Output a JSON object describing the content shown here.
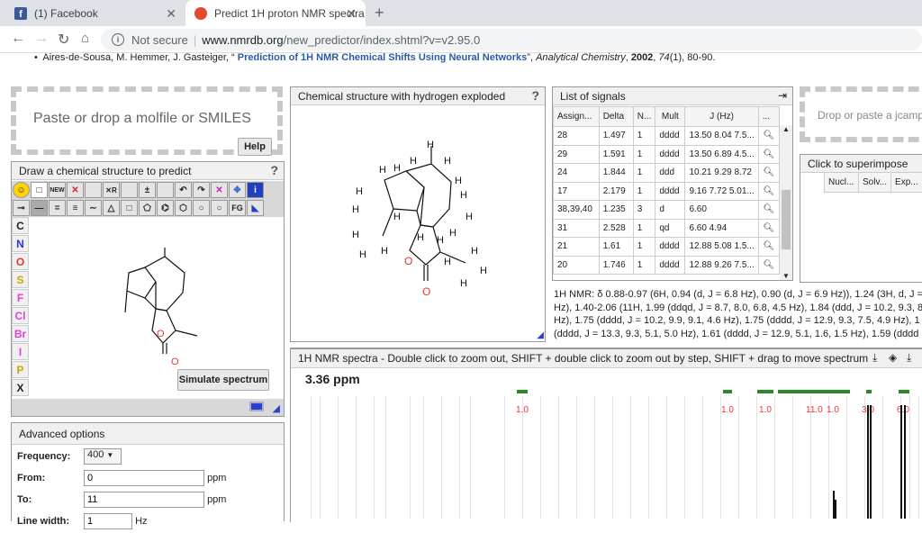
{
  "browser": {
    "tabs": [
      {
        "title": "(1) Facebook",
        "icon": "facebook-icon",
        "color": "#3b5998"
      },
      {
        "title": "Predict 1H proton NMR spectra",
        "icon": "nmrdb-icon",
        "color": "#e04b2b"
      }
    ],
    "not_secure": "Not secure",
    "url_host": "www.nmrdb.org",
    "url_path": "/new_predictor/index.shtml?v=v2.95.0"
  },
  "reference": {
    "authors": "Aires-de-Sousa, M. Hemmer, J. Gasteiger, “ ",
    "title": "Prediction of 1H NMR Chemical Shifts Using Neural Networks",
    "journal_pre": "”, ",
    "journal": "Analytical Chemistry",
    "sep1": ", ",
    "year": "2002",
    "sep2": ", ",
    "volume": "74",
    "pages": "(1), 80-90."
  },
  "paste": {
    "placeholder": "Paste or drop a molfile or SMILES",
    "help": "Help"
  },
  "editor": {
    "title": "Draw a chemical structure to predict",
    "help": "?",
    "atoms": [
      "C",
      "N",
      "O",
      "S",
      "F",
      "Cl",
      "Br",
      "I",
      "P",
      "X"
    ],
    "atom_colors": [
      "#333",
      "#2d33d8",
      "#e33",
      "#c8a800",
      "#d4d",
      "#d4d",
      "#d4d",
      "#d4d",
      "#c8a800",
      "#333"
    ],
    "simulate": "Simulate spectrum",
    "tool_new": "NEW",
    "tool_fg": "FG"
  },
  "exploded": {
    "title": "Chemical structure with hydrogen exploded",
    "help": "?"
  },
  "signals": {
    "title": "List of signals",
    "columns": [
      "Assign...",
      "Delta",
      "N...",
      "Mult",
      "J (Hz)",
      "..."
    ],
    "rows": [
      [
        "28",
        "1.497",
        "1",
        "dddd",
        "13.50 8.04 7.5..."
      ],
      [
        "29",
        "1.591",
        "1",
        "dddd",
        "13.50 6.89 4.5..."
      ],
      [
        "24",
        "1.844",
        "1",
        "ddd",
        "10.21 9.29 8.72"
      ],
      [
        "17",
        "2.179",
        "1",
        "dddd",
        "9.16 7.72 5.01..."
      ],
      [
        "38,39,40",
        "1.235",
        "3",
        "d",
        "6.60"
      ],
      [
        "31",
        "2.528",
        "1",
        "qd",
        "6.60 4.94"
      ],
      [
        "21",
        "1.61",
        "1",
        "dddd",
        "12.88 5.08 1.5..."
      ],
      [
        "20",
        "1.746",
        "1",
        "dddd",
        "12.88 9.26 7.5..."
      ]
    ]
  },
  "nmr_text": {
    "line1": "1H NMR: δ 0.88-0.97 (6H, 0.94 (d, J = 6.8 Hz), 0.90 (d, J = 6.9 Hz)), 1.24 (3H, d, J =",
    "line2": "Hz), 1.40-2.06 (11H, 1.99 (ddqd, J = 8.7, 8.0, 6.8, 4.5 Hz), 1.84 (ddd, J = 10.2, 9.3, 8.",
    "line3": "Hz), 1.75 (dddd, J = 10.2, 9.9, 9.1, 4.6 Hz), 1.75 (dddd, J = 12.9, 9.3, 7.5, 4.9 Hz), 1",
    "line4": "(dddd, J = 13.3, 9.3, 5.1, 5.0 Hz), 1.61 (dddd, J = 12.9, 5.1, 1.6, 1.5 Hz), 1.59 (dddd"
  },
  "jcamp": {
    "placeholder": "Drop or paste a jcamp"
  },
  "superimpose": {
    "title": "Click to superimpose",
    "columns": [
      "Nucl...",
      "Solv...",
      "Exp..."
    ]
  },
  "advanced": {
    "title": "Advanced options",
    "frequency_label": "Frequency:",
    "frequency": "400",
    "from_label": "From:",
    "from": "0",
    "from_unit": "ppm",
    "to_label": "To:",
    "to": "11",
    "to_unit": "ppm",
    "lw_label": "Line width:",
    "lw": "1",
    "lw_unit": "Hz"
  },
  "spectrum": {
    "title": "1H NMR spectra - Double click to zoom out, SHIFT + double click to zoom out by step, SHIFT + drag to move spectrum",
    "cursor_ppm": "3.36 ppm",
    "integrals": [
      "1.0",
      "1.0",
      "1.0",
      "11.0",
      "1.0",
      "3.0",
      "6.0"
    ]
  },
  "structure_labels": {
    "H": "H",
    "O": "O"
  }
}
